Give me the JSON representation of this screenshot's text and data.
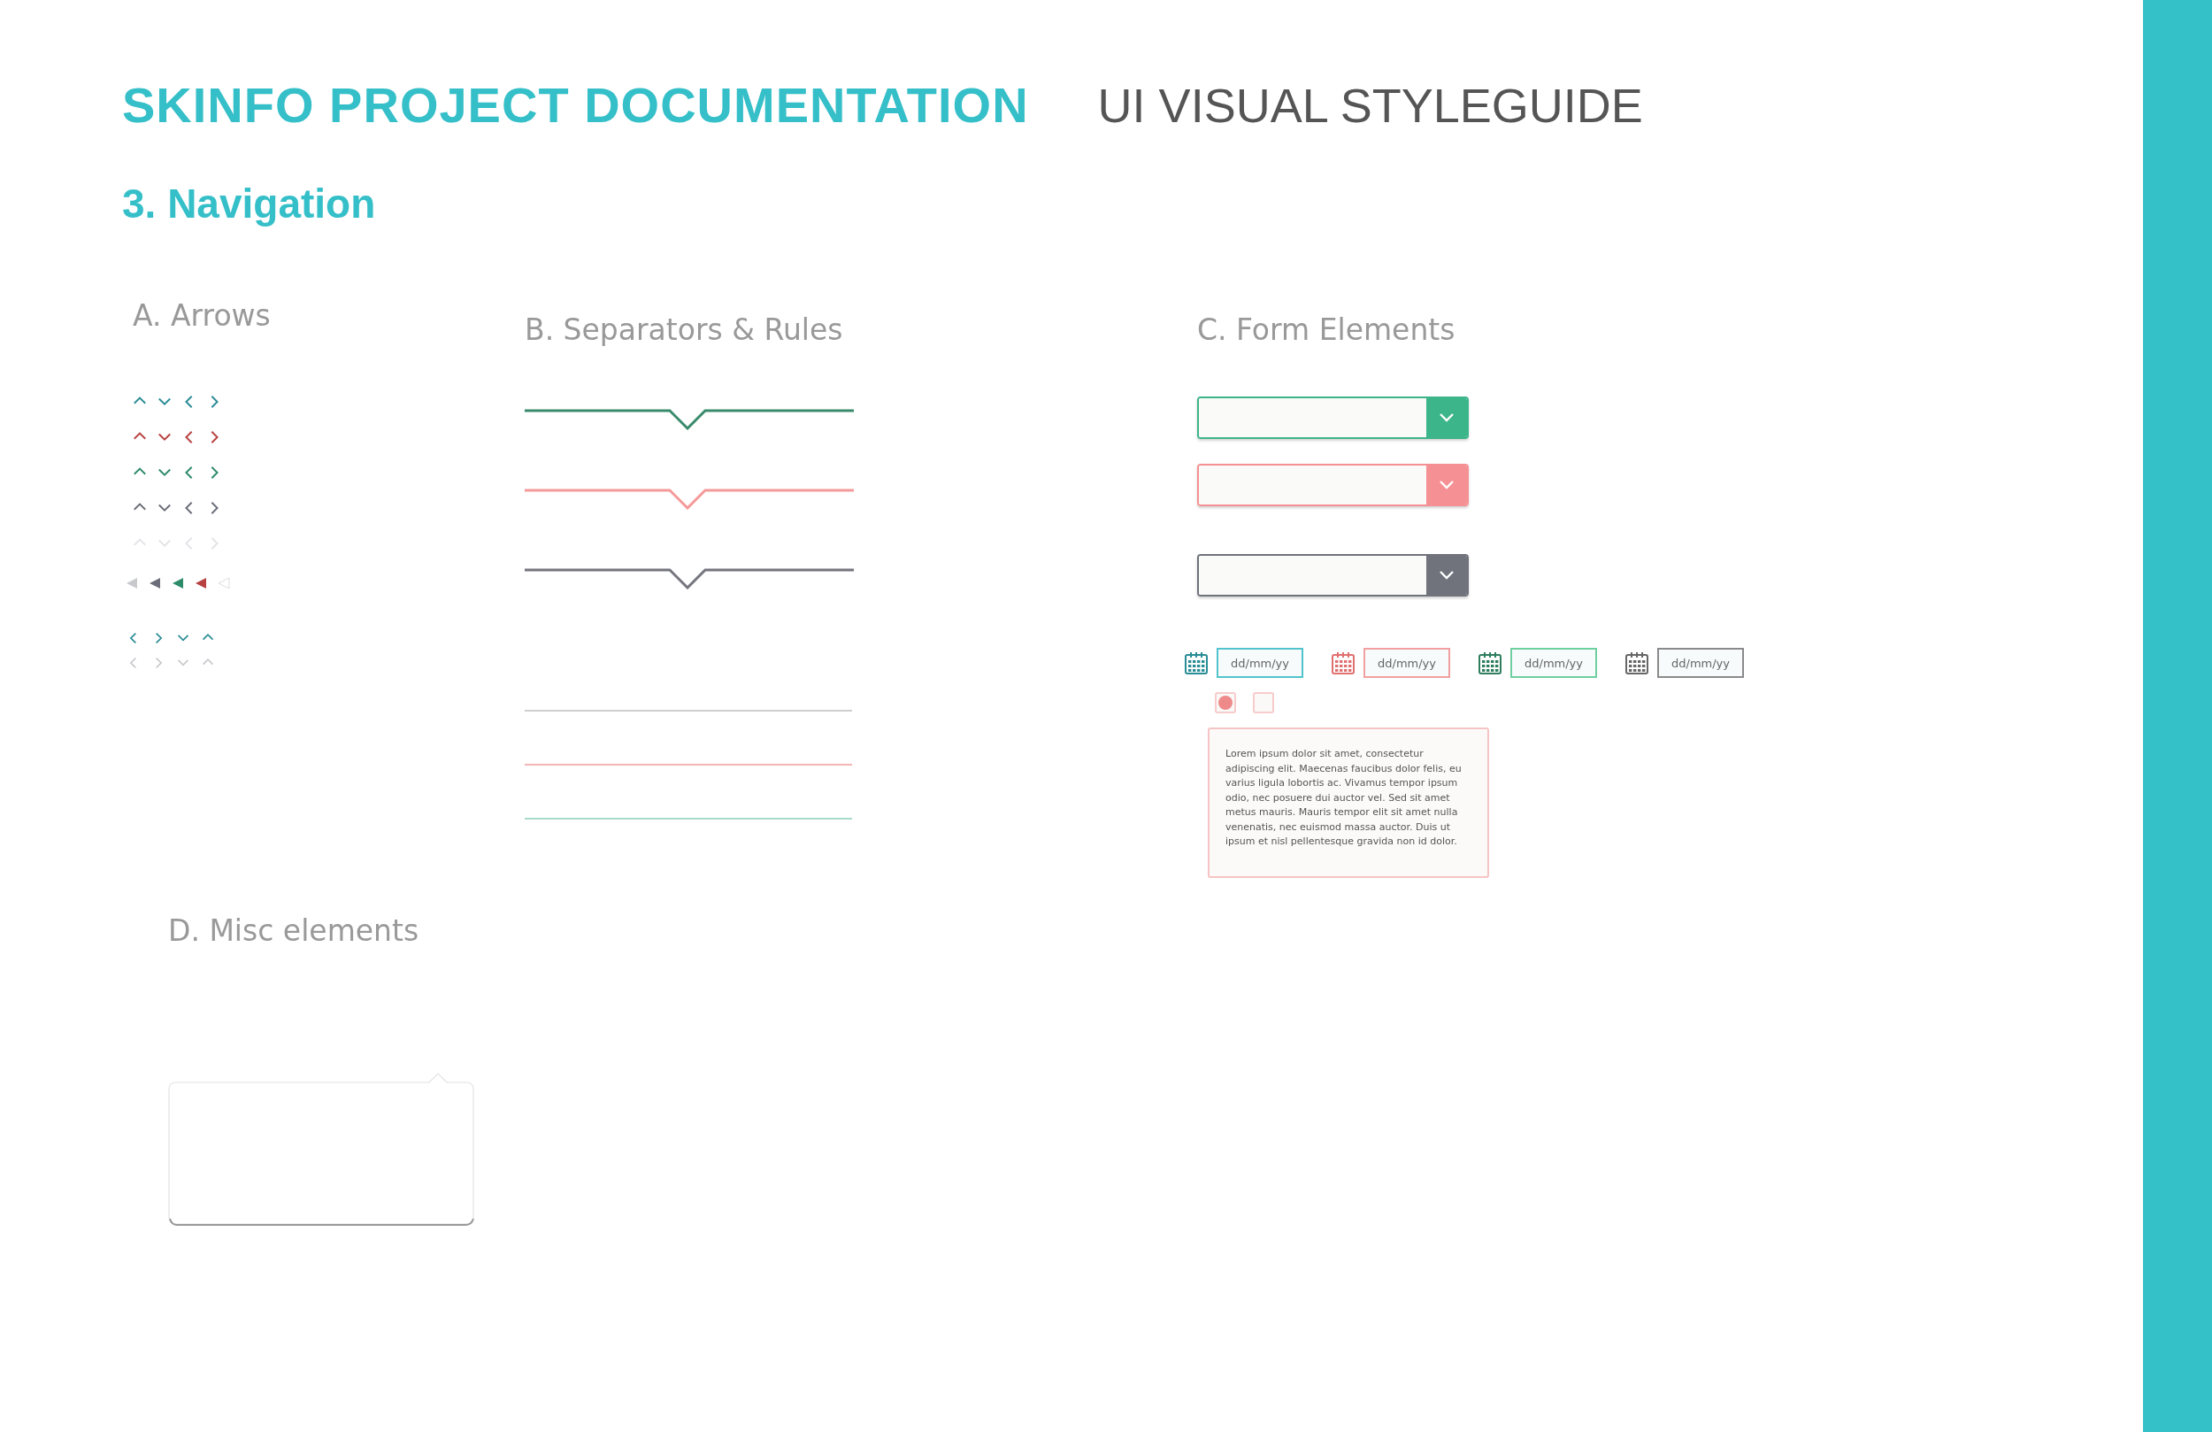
{
  "header": {
    "title": "SKINFO PROJECT DOCUMENTATION",
    "subtitle": "UI VISUAL STYLEGUIDE"
  },
  "section": "3. Navigation",
  "arrows": {
    "heading": "A. Arrows",
    "chevron_rows": [
      {
        "color": "#2a8c96"
      },
      {
        "color": "#b84040"
      },
      {
        "color": "#2e8b6a"
      },
      {
        "color": "#6b6e78"
      },
      {
        "color": "#e4e4e8"
      }
    ],
    "triangles": [
      {
        "color": "#c8c9cd"
      },
      {
        "color": "#6b6e78"
      },
      {
        "color": "#2e8b6a"
      },
      {
        "color": "#b84040"
      },
      {
        "color": "#eeeeee"
      }
    ],
    "small_rows": [
      {
        "color": "#2a8c96"
      },
      {
        "color": "#c8c9cd"
      }
    ]
  },
  "separators": {
    "heading": "B. Separators & Rules",
    "notched": [
      {
        "color": "#3a8a6c"
      },
      {
        "color": "#f59a9a"
      },
      {
        "color": "#74757e"
      }
    ],
    "rules": [
      {
        "color": "#cfcfcf"
      },
      {
        "color": "#f5b5b5"
      },
      {
        "color": "#a8dcc8"
      }
    ]
  },
  "forms": {
    "heading": "C. Form Elements",
    "dropdowns": [
      {
        "color": "#3db58a"
      },
      {
        "color": "#f59194"
      },
      {
        "color": "#70737c"
      }
    ],
    "date_fields": [
      {
        "placeholder": "dd/mm/yy",
        "color": "#52c3cc",
        "icon": {
          "color": "#2a8c96"
        }
      },
      {
        "placeholder": "dd/mm/yy",
        "color": "#f0a0a0",
        "icon": {
          "color": "#e07070"
        }
      },
      {
        "placeholder": "dd/mm/yy",
        "color": "#6fcfa0",
        "icon": {
          "color": "#2e7d5e"
        }
      },
      {
        "placeholder": "dd/mm/yy",
        "color": "#8a8a8a",
        "icon": {
          "color": "#666666"
        }
      }
    ],
    "radio": {
      "checked": true
    },
    "checkbox": {
      "checked": false
    },
    "textarea": {
      "value": "Lorem ipsum dolor sit amet, consectetur adipiscing elit. Maecenas faucibus dolor felis, eu varius ligula lobortis ac. Vivamus tempor ipsum odio, nec posuere dui auctor vel. Sed sit amet metus mauris. Mauris tempor elit sit amet nulla venenatis, nec euismod massa auctor. Duis ut ipsum et nisl pellentesque gravida non id dolor."
    }
  },
  "misc": {
    "heading": "D. Misc elements"
  }
}
